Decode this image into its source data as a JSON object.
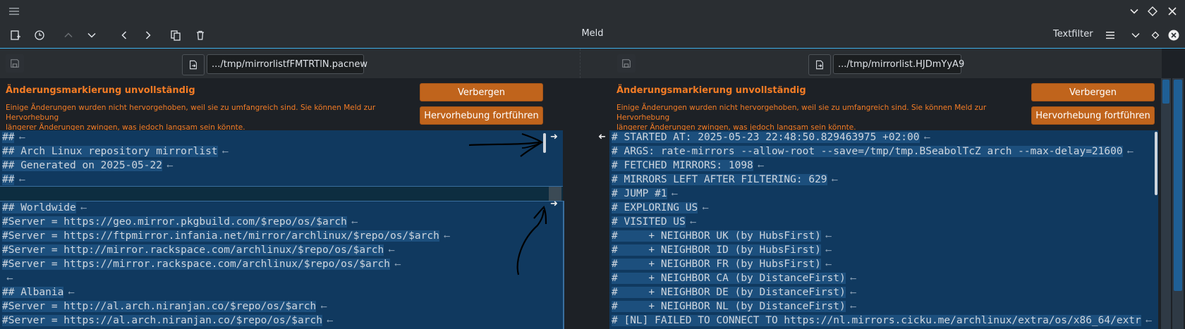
{
  "app": {
    "title": "Meld",
    "filter_label": "Textfilter"
  },
  "window_controls": [
    "chevron-down-icon",
    "diamond-icon",
    "close-icon"
  ],
  "toolbar_icons": [
    "new-comparison-icon",
    "history-icon",
    "previous-change-icon",
    "next-change-icon",
    "left-arrow-icon",
    "right-arrow-icon",
    "copy-icon",
    "delete-icon"
  ],
  "files": {
    "left": {
      "path": ".../tmp/mirrorlistfFMTRTlN.pacnew"
    },
    "right": {
      "path": ".../tmp/mirrorlist.HJDmYyA9"
    }
  },
  "info_bar": {
    "heading": "Änderungsmarkierung unvollständig",
    "message_line1": "Einige Änderungen wurden nicht hervorgehoben, weil sie zu umfangreich sind. Sie können Meld zur Hervorhebung",
    "message_line2": "längerer Änderungen zwingen, was jedoch langsam sein könnte.",
    "hide_button": "Verbergen",
    "continue_button": "Hervorhebung fortführen"
  },
  "left_lines": [
    "##",
    "## Arch Linux repository mirrorlist",
    "## Generated on 2025-05-22",
    "##",
    "",
    "## Worldwide",
    "#Server = https://geo.mirror.pkgbuild.com/$repo/os/$arch",
    "#Server = https://ftpmirror.infania.net/mirror/archlinux/$repo/os/$arch",
    "#Server = http://mirror.rackspace.com/archlinux/$repo/os/$arch",
    "#Server = https://mirror.rackspace.com/archlinux/$repo/os/$arch",
    "",
    "## Albania",
    "#Server = http://al.arch.niranjan.co/$repo/os/$arch",
    "#Server = https://al.arch.niranjan.co/$repo/os/$arch"
  ],
  "right_lines": [
    "# STARTED AT: 2025-05-23 22:48:50.829463975 +02:00",
    "# ARGS: rate-mirrors --allow-root --save=/tmp/tmp.BSeabolTcZ arch --max-delay=21600",
    "# FETCHED MIRRORS: 1098",
    "# MIRRORS LEFT AFTER FILTERING: 629",
    "# JUMP #1",
    "# EXPLORING US",
    "# VISITED US",
    "#     + NEIGHBOR UK (by HubsFirst)",
    "#     + NEIGHBOR ID (by HubsFirst)",
    "#     + NEIGHBOR FR (by HubsFirst)",
    "#     + NEIGHBOR CA (by DistanceFirst)",
    "#     + NEIGHBOR DE (by DistanceFirst)",
    "#     + NEIGHBOR NL (by DistanceFirst)",
    "# [NL] FAILED TO CONNECT TO https://nl.mirrors.cicku.me/archlinux/extra/os/x86_64/extr"
  ],
  "colors": {
    "accent": "#3daee9",
    "warning_text": "#f47c25",
    "button_orange": "#c0641c",
    "changed_block": "#10395f"
  }
}
